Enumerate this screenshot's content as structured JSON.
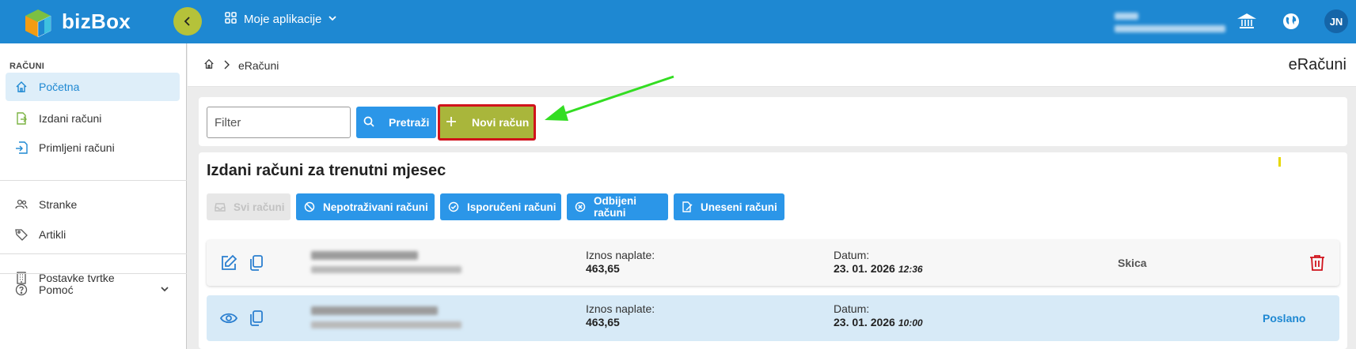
{
  "app": {
    "brand": "bizBox"
  },
  "topbar": {
    "apps_label": "Moje aplikacije",
    "avatar_initials": "JN"
  },
  "sidebar": {
    "section_header": "RAČUNI",
    "items": [
      {
        "label": "Početna",
        "icon": "home-icon"
      },
      {
        "label": "Izdani računi",
        "icon": "invoice-out-icon"
      },
      {
        "label": "Primljeni računi",
        "icon": "invoice-in-icon"
      },
      {
        "label": "Stranke",
        "icon": "people-icon"
      },
      {
        "label": "Artikli",
        "icon": "tag-icon"
      },
      {
        "label": "Postavke tvrtke",
        "icon": "building-icon"
      },
      {
        "label": "Pomoć",
        "icon": "help-icon"
      }
    ]
  },
  "breadcrumb": {
    "current": "eRačuni"
  },
  "page_title": "eRačuni",
  "filter": {
    "placeholder": "Filter",
    "search_label": "Pretraži",
    "new_label": "Novi račun"
  },
  "section_title": "Izdani računi za trenutni mjesec",
  "tabs": [
    {
      "label": "Svi računi",
      "disabled": true
    },
    {
      "label": "Nepotraživani računi"
    },
    {
      "label": "Isporučeni računi"
    },
    {
      "label": "Odbijeni računi"
    },
    {
      "label": "Uneseni računi"
    }
  ],
  "invoices": [
    {
      "amount_label": "Iznos naplate:",
      "amount": "463,65",
      "date_label": "Datum:",
      "date": "23. 01. 2026",
      "time": "12:36",
      "status": "Skica"
    },
    {
      "amount_label": "Iznos naplate:",
      "amount": "463,65",
      "date_label": "Datum:",
      "date": "23. 01. 2026",
      "time": "10:00",
      "status": "Poslano"
    }
  ],
  "colors": {
    "topbar": "#1e88d2",
    "accent_blue": "#2b96e8",
    "new_button": "#a9b63b",
    "highlight_border": "#d0121b",
    "annotation_arrow": "#33dd22"
  }
}
